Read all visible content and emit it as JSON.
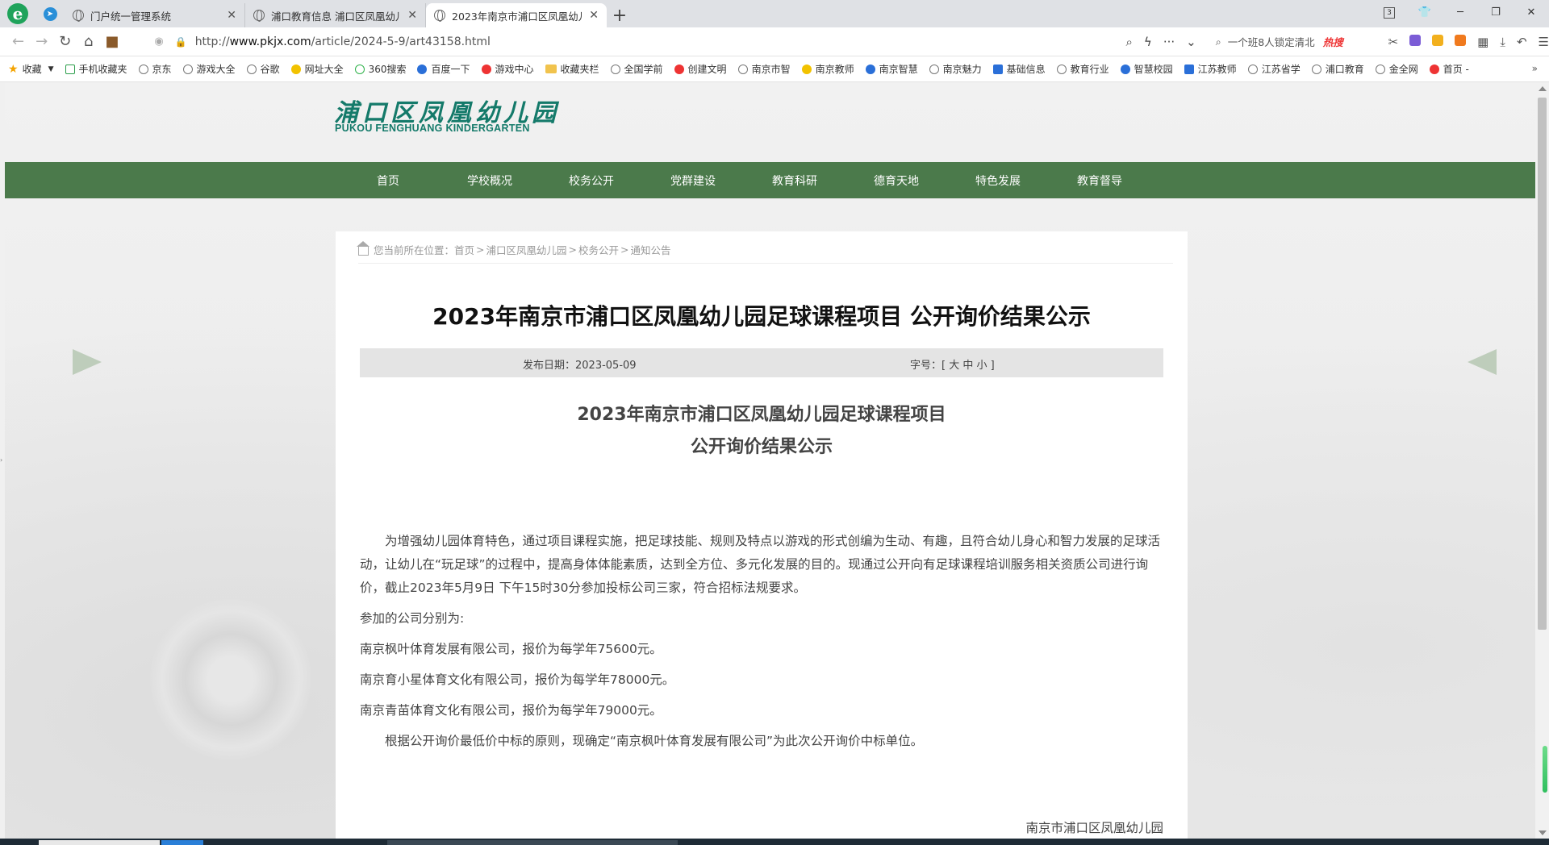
{
  "browser": {
    "tabs": [
      {
        "title": "门户统一管理系统",
        "active": false
      },
      {
        "title": "浦口教育信息 浦口区凤凰幼儿",
        "active": false
      },
      {
        "title": "2023年南京市浦口区凤凰幼儿",
        "active": true
      }
    ],
    "window_badge": "3",
    "url_prefix": "http://",
    "url_domain": "www.pkjx.com",
    "url_path": "/article/2024-5-9/art43158.html",
    "search_text": "一个班8人锁定清北",
    "search_hot": "热搜",
    "bookmarks": [
      {
        "label": "收藏",
        "icon": "star"
      },
      {
        "label": "手机收藏夹",
        "icon": "phone"
      },
      {
        "label": "京东",
        "icon": "globe"
      },
      {
        "label": "游戏大全",
        "icon": "globe"
      },
      {
        "label": "谷歌",
        "icon": "globe"
      },
      {
        "label": "网址大全",
        "icon": "yellow"
      },
      {
        "label": "360搜索",
        "icon": "globe"
      },
      {
        "label": "百度一下",
        "icon": "blue"
      },
      {
        "label": "游戏中心",
        "icon": "red"
      },
      {
        "label": "收藏夹栏",
        "icon": "folder"
      },
      {
        "label": "全国学前",
        "icon": "globe"
      },
      {
        "label": "创建文明",
        "icon": "red"
      },
      {
        "label": "南京市智",
        "icon": "globe"
      },
      {
        "label": "南京教师",
        "icon": "yellow"
      },
      {
        "label": "南京智慧",
        "icon": "blue"
      },
      {
        "label": "南京魅力",
        "icon": "globe"
      },
      {
        "label": "基础信息",
        "icon": "blue"
      },
      {
        "label": "教育行业",
        "icon": "globe"
      },
      {
        "label": "智慧校园",
        "icon": "blue"
      },
      {
        "label": "江苏教师",
        "icon": "blue"
      },
      {
        "label": "江苏省学",
        "icon": "globe"
      },
      {
        "label": "浦口教育",
        "icon": "globe"
      },
      {
        "label": "金全网",
        "icon": "globe"
      },
      {
        "label": "首页 -",
        "icon": "red"
      }
    ]
  },
  "site": {
    "logo_cn": "浦口区凤凰幼儿园",
    "logo_en": "PUKOU FENGHUANG KINDERGARTEN",
    "nav": [
      "首页",
      "学校概况",
      "校务公开",
      "党群建设",
      "教育科研",
      "德育天地",
      "特色发展",
      "教育督导"
    ]
  },
  "breadcrumb": {
    "prefix": "您当前所在位置：",
    "items": [
      "首页",
      "浦口区凤凰幼儿园",
      "校务公开",
      "通知公告"
    ]
  },
  "article": {
    "title": "2023年南京市浦口区凤凰幼儿园足球课程项目 公开询价结果公示",
    "date_label": "发布日期：",
    "date": "2023-05-09",
    "font_size_label": "字号：[ 大 中 小 ]",
    "subtitle_line1": "2023年南京市浦口区凤凰幼儿园足球课程项目",
    "subtitle_line2": "公开询价结果公示",
    "paragraphs": [
      "为增强幼儿园体育特色，通过项目课程实施，把足球技能、规则及特点以游戏的形式创编为生动、有趣，且符合幼儿身心和智力发展的足球活动，让幼儿在“玩足球”的过程中，提高身体体能素质，达到全方位、多元化发展的目的。现通过公开向有足球课程培训服务相关资质公司进行询价，截止2023年5月9日 下午15时30分参加投标公司三家，符合招标法规要求。",
      "参加的公司分别为:",
      "南京枫叶体育发展有限公司，报价为每学年75600元。",
      "南京育小星体育文化有限公司，报价为每学年78000元。",
      "南京青苗体育文化有限公司，报价为每学年79000元。",
      "根据公开询价最低价中标的原则，现确定“南京枫叶体育发展有限公司”为此次公开询价中标单位。"
    ],
    "signature": "南京市浦口区凤凰幼儿园"
  }
}
